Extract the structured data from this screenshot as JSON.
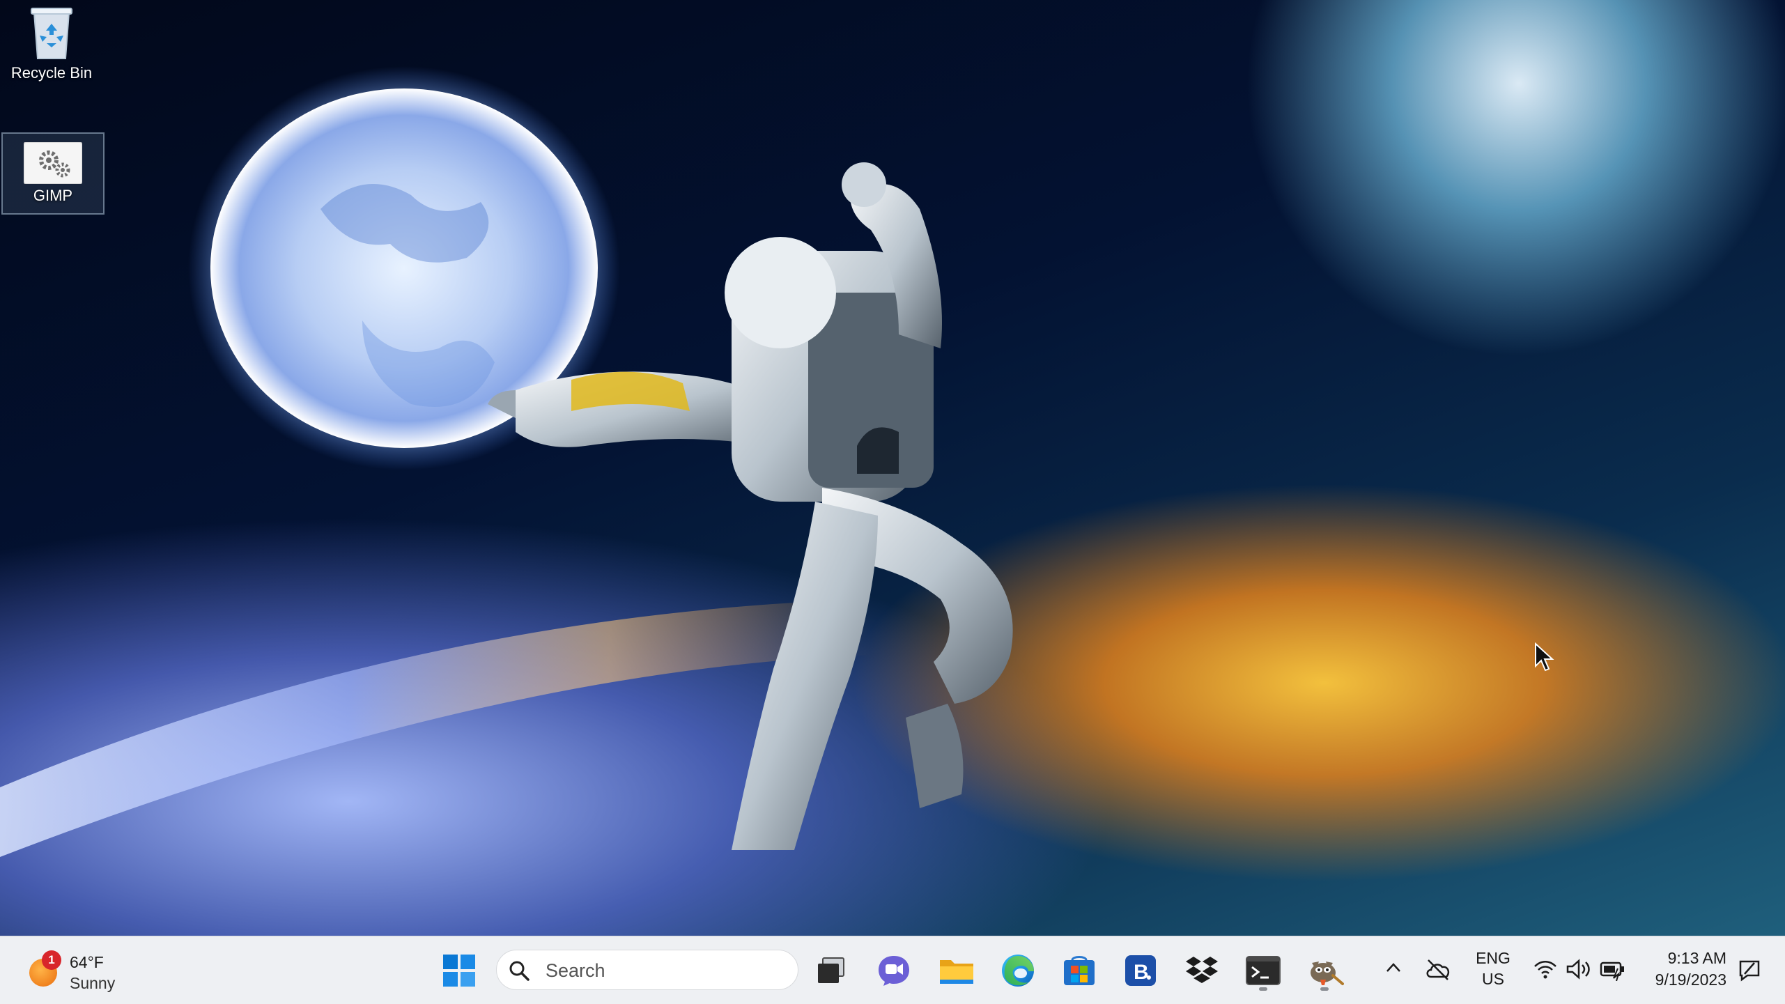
{
  "desktop": {
    "icons": [
      {
        "label": "Recycle Bin",
        "icon": "recycle-bin-icon"
      },
      {
        "label": "GIMP",
        "icon": "gimp-gear-icon"
      }
    ],
    "wallpaper": "astronaut-reaching-for-moon-over-planet"
  },
  "taskbar": {
    "weather": {
      "temperature": "64°F",
      "condition": "Sunny",
      "badge": "1"
    },
    "search": {
      "placeholder": "Search"
    },
    "pinned_apps": [
      {
        "name": "Task View",
        "icon": "task-view-icon"
      },
      {
        "name": "Chat",
        "icon": "chat-icon"
      },
      {
        "name": "File Explorer",
        "icon": "folder-icon"
      },
      {
        "name": "Microsoft Edge",
        "icon": "edge-icon"
      },
      {
        "name": "Microsoft Store",
        "icon": "store-icon"
      },
      {
        "name": "B",
        "icon": "b-app-icon"
      },
      {
        "name": "Dropbox",
        "icon": "dropbox-icon"
      },
      {
        "name": "Terminal",
        "icon": "terminal-icon",
        "running": true
      },
      {
        "name": "GIMP",
        "icon": "gimp-icon",
        "running": true
      }
    ],
    "tray": {
      "lang_line1": "ENG",
      "lang_line2": "US",
      "time": "9:13 AM",
      "date": "9/19/2023"
    }
  },
  "colors": {
    "taskbar_bg": "#eef0f3",
    "accent": "#0a78d4",
    "badge": "#d8262b"
  }
}
